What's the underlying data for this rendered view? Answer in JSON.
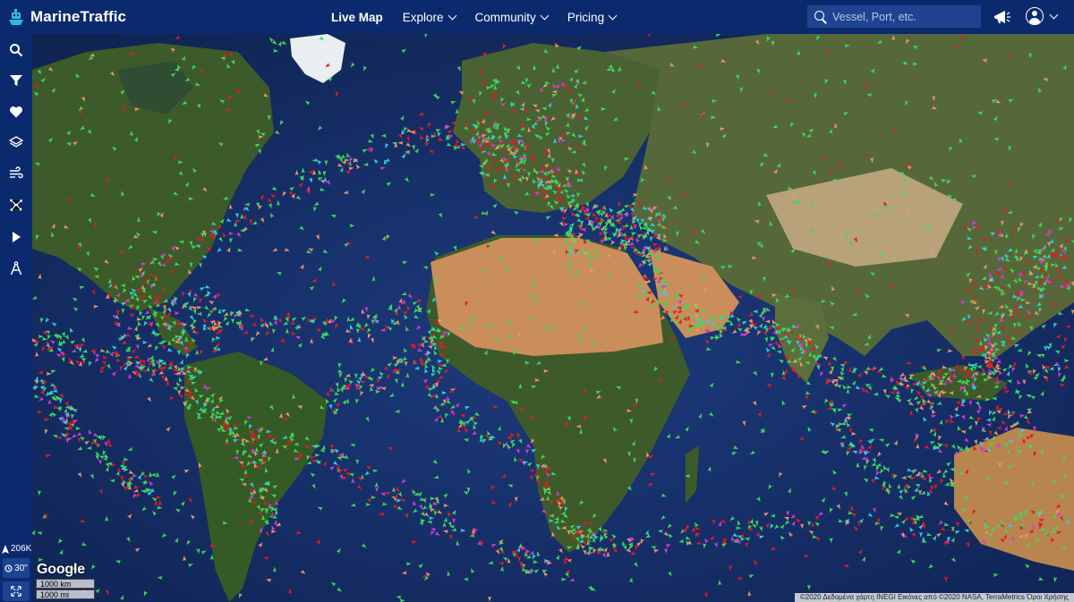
{
  "app": {
    "brand": "MarineTraffic"
  },
  "nav": {
    "live_map": "Live Map",
    "explore": "Explore",
    "community": "Community",
    "pricing": "Pricing"
  },
  "search": {
    "placeholder": "Vessel, Port, etc."
  },
  "sidebar": {
    "items": [
      {
        "name": "search-icon"
      },
      {
        "name": "filter-icon"
      },
      {
        "name": "heart-icon"
      },
      {
        "name": "layers-icon"
      },
      {
        "name": "weather-wind-icon"
      },
      {
        "name": "density-icon"
      },
      {
        "name": "play-icon"
      },
      {
        "name": "measure-icon"
      }
    ],
    "vessel_count": "206K",
    "refresh": "30\"",
    "fullscreen": "fullscreen"
  },
  "map": {
    "provider": "Google",
    "scale_km": "1000 km",
    "scale_mi": "1000 mi",
    "attribution": "©2020 Δεδομένα χάρτη INEGI Εικόνες από ©2020 NASA, TerraMetrics   Όροι Χρήσης",
    "colors": {
      "ocean": "#142a63",
      "land_green": "#3d5a2a",
      "desert": "#c98e5a",
      "ice": "#e8eef2",
      "cargo": "#3ddb5b",
      "tanker": "#e31b23",
      "passenger": "#2fd1e6",
      "fishing": "#f0966b",
      "pleasure": "#d43bd6"
    }
  }
}
